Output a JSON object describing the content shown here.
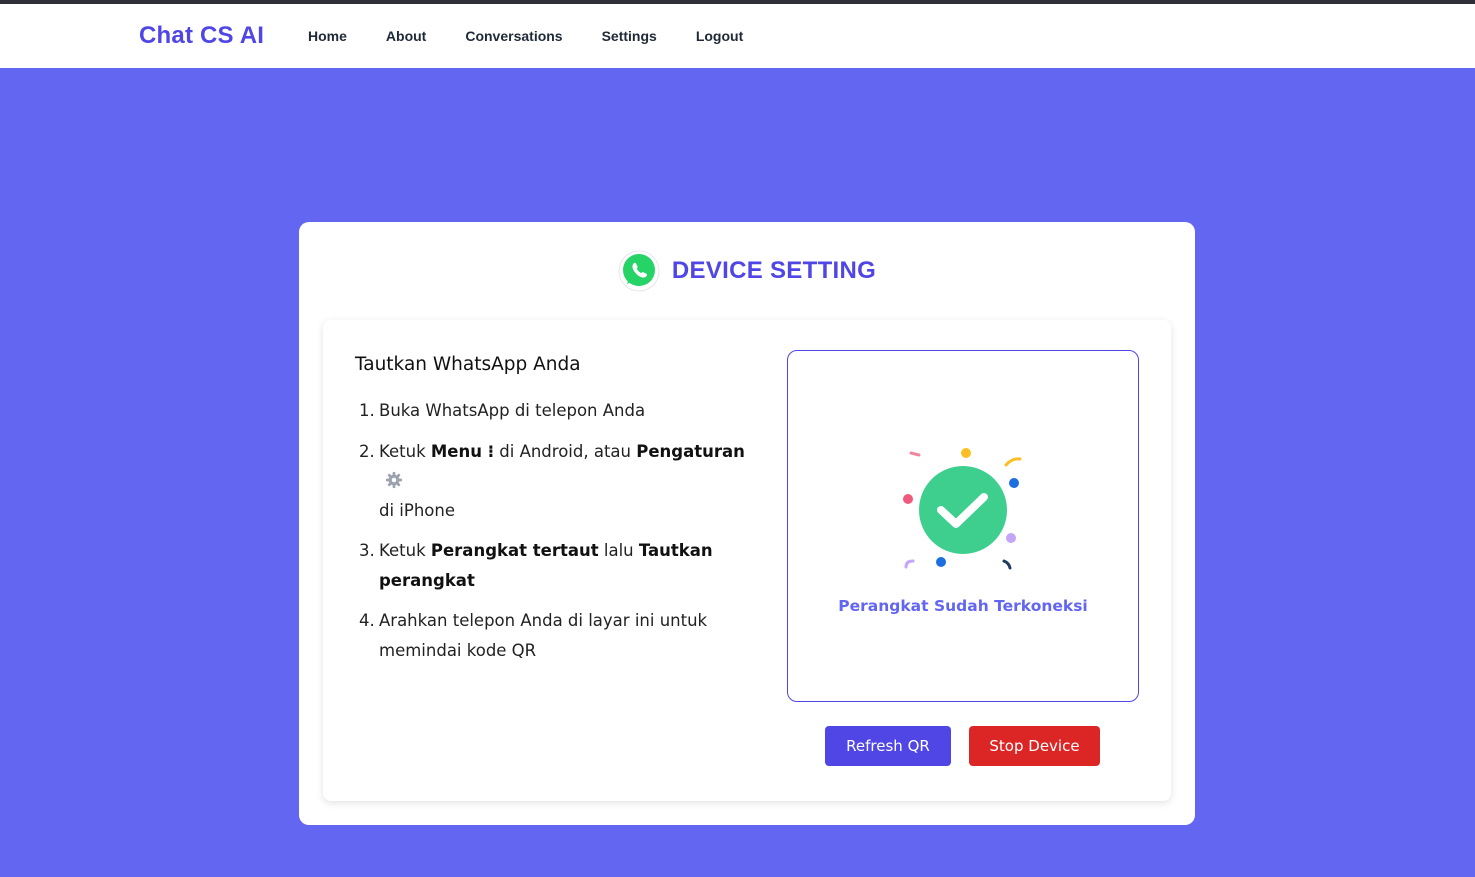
{
  "nav": {
    "brand": "Chat CS AI",
    "links": [
      "Home",
      "About",
      "Conversations",
      "Settings",
      "Logout"
    ]
  },
  "card": {
    "title": "DEVICE SETTING"
  },
  "instructions": {
    "title": "Tautkan WhatsApp Anda",
    "steps": [
      {
        "num": "1.",
        "parts": [
          "Buka WhatsApp di telepon Anda"
        ]
      },
      {
        "num": "2.",
        "parts": [
          "Ketuk ",
          "Menu ⁝",
          " di Android, atau ",
          "Pengaturan",
          "di iPhone"
        ]
      },
      {
        "num": "3.",
        "parts": [
          "Ketuk ",
          "Perangkat tertaut",
          " lalu ",
          "Tautkan perangkat"
        ]
      },
      {
        "num": "4.",
        "parts": [
          "Arahkan telepon Anda di layar ini untuk memindai kode QR"
        ]
      }
    ]
  },
  "device_status": {
    "text": "Perangkat Sudah Terkoneksi"
  },
  "buttons": {
    "refresh": "Refresh QR",
    "stop": "Stop Device"
  },
  "colors": {
    "background": "#6366f1",
    "brand": "#4f46e5",
    "success": "#3ecf8e",
    "danger": "#dc2626",
    "whatsapp": "#25d366"
  },
  "icons": {
    "whatsapp": "whatsapp-icon",
    "gear": "gear-icon",
    "check": "check-circle-icon"
  }
}
